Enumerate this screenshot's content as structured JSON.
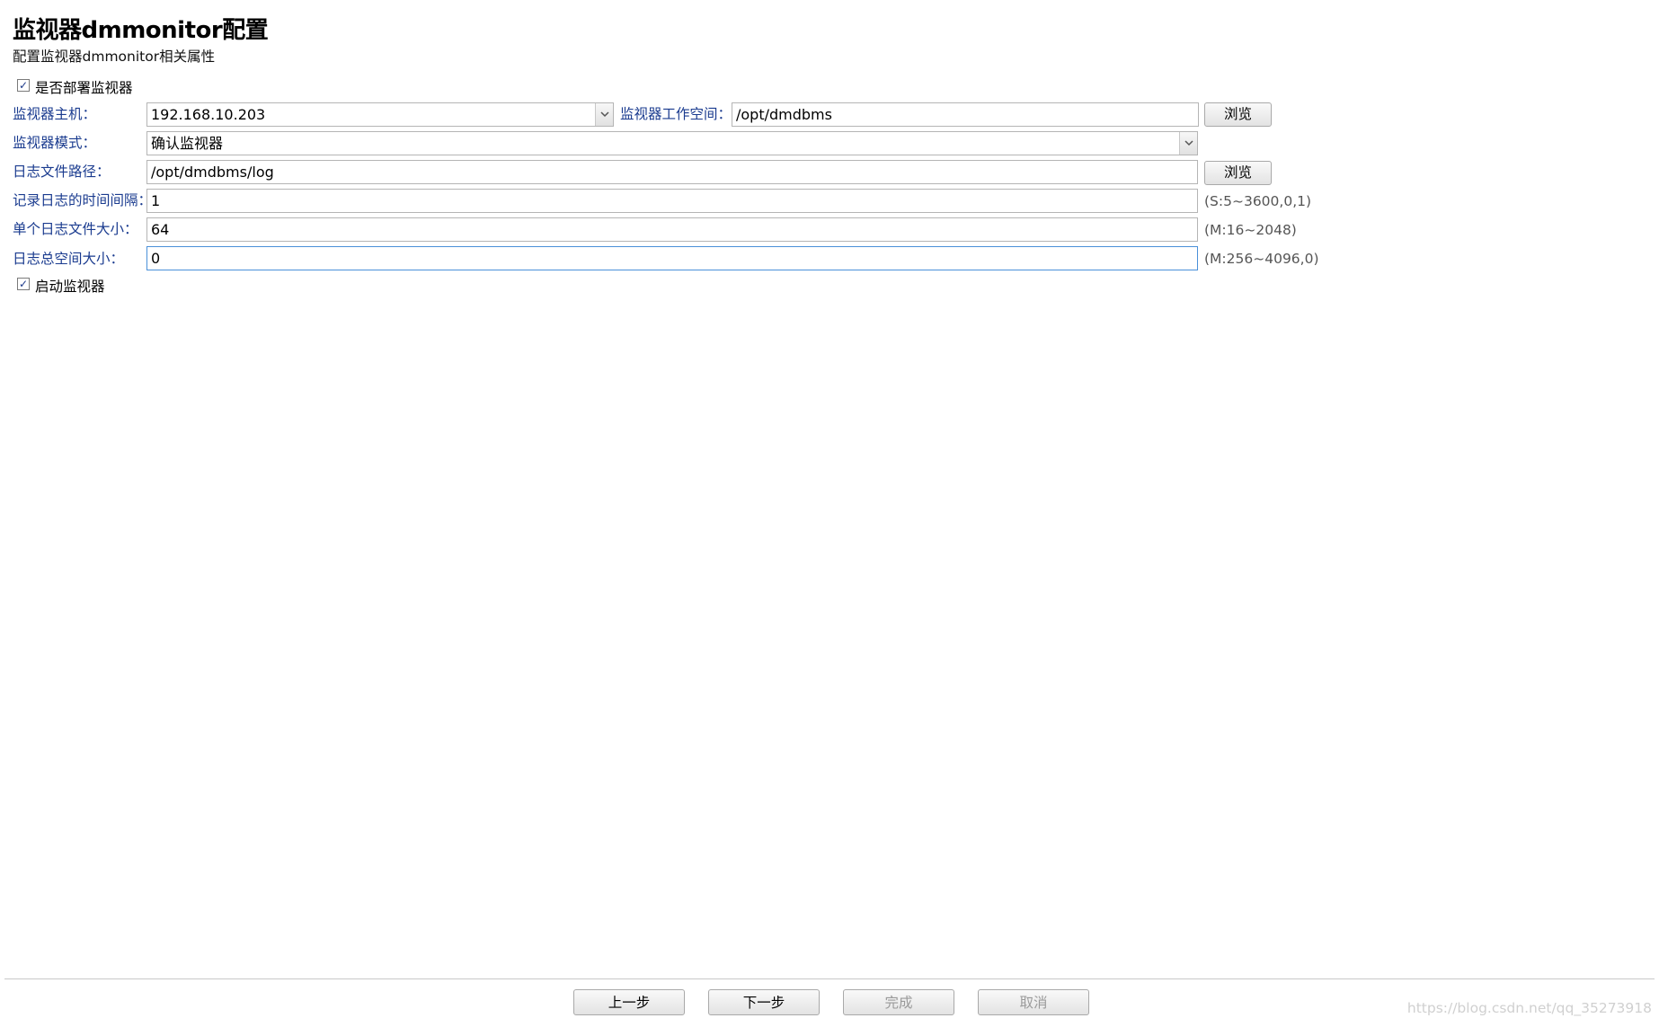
{
  "header": {
    "title": "监视器dmmonitor配置",
    "subtitle": "配置监视器dmmonitor相关属性"
  },
  "deploy": {
    "label": "是否部署监视器",
    "checked": true
  },
  "host": {
    "label": "监视器主机：",
    "value": "192.168.10.203"
  },
  "workspace": {
    "label": "监视器工作空间：",
    "value": "/opt/dmdbms",
    "browse_label": "浏览"
  },
  "mode": {
    "label": "监视器模式：",
    "value": "确认监视器"
  },
  "log_path": {
    "label": "日志文件路径：",
    "value": "/opt/dmdbms/log",
    "browse_label": "浏览"
  },
  "log_interval": {
    "label": "记录日志的时间间隔：",
    "value": "1",
    "hint": "(S:5~3600,0,1)"
  },
  "log_file_size": {
    "label": "单个日志文件大小：",
    "value": "64",
    "hint": "(M:16~2048)"
  },
  "log_total_size": {
    "label": "日志总空间大小：",
    "value": "0",
    "hint": "(M:256~4096,0)"
  },
  "start": {
    "label": "启动监视器",
    "checked": true
  },
  "footer": {
    "prev_label": "上一步",
    "next_label": "下一步",
    "finish_label": "完成",
    "cancel_label": "取消"
  },
  "watermark": "https://blog.csdn.net/qq_35273918",
  "colors": {
    "label": "#1a3b8f",
    "focus_border": "#4a90d9",
    "hint": "#555555"
  }
}
